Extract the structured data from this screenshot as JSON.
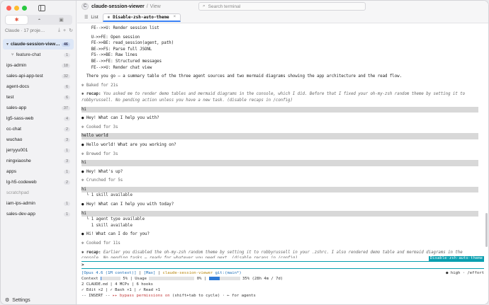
{
  "sidebar": {
    "segments": [
      "✱",
      "◓",
      "▣"
    ],
    "header": "Claude · 17 proje…",
    "projects": [
      {
        "name": "claude-session-view…",
        "count": "46",
        "active": true
      },
      {
        "name": "feature-chat",
        "count": "1",
        "sub": true
      },
      {
        "name": "ips-admin",
        "count": "18"
      },
      {
        "name": "sales-api-app-test",
        "count": "32"
      },
      {
        "name": "agent-docs",
        "count": "6"
      },
      {
        "name": "test",
        "count": "6"
      },
      {
        "name": "sales-app",
        "count": "37"
      },
      {
        "name": "lg5-sass-web",
        "count": "4"
      },
      {
        "name": "cc-chat",
        "count": "2"
      },
      {
        "name": "wuchao",
        "count": "3"
      },
      {
        "name": "jerryyu001",
        "count": "1"
      },
      {
        "name": "ningxiaoshe",
        "count": "3"
      },
      {
        "name": "apps",
        "count": "1"
      },
      {
        "name": "lg-h5-codeweb",
        "count": "2"
      },
      {
        "name": "scratchpad",
        "count": "",
        "muted": true
      },
      {
        "name": "iam-ips-admin",
        "count": "1"
      },
      {
        "name": "sales-dev-app",
        "count": "1"
      }
    ],
    "settings_label": "Settings"
  },
  "topbar": {
    "app_logo": "C",
    "project": "claude-session-viewer",
    "view": "View",
    "search_placeholder": "Search terminal"
  },
  "tabs": [
    {
      "label": "List",
      "active": false
    },
    {
      "label": "Disable-zsh-auto-theme",
      "active": true
    }
  ],
  "terminal": {
    "lines": [
      {
        "k": "t",
        "text": "    FE-->>U: Render session list"
      },
      {
        "k": "g"
      },
      {
        "k": "t",
        "text": "    U->>FE: Open session"
      },
      {
        "k": "t",
        "text": "    FE->>BE: read_session(agent, path)"
      },
      {
        "k": "t",
        "text": "    BE->>FS: Parse full JSONL"
      },
      {
        "k": "t",
        "text": "    FS-->>BE: Raw lines"
      },
      {
        "k": "t",
        "text": "    BE-->>FE: Structured messages"
      },
      {
        "k": "t",
        "text": "    FE-->>U: Render chat view"
      },
      {
        "k": "g"
      },
      {
        "k": "t",
        "text": "  There you go — a summary table of the three agent sources and two mermaid diagrams showing the app architecture and the read flow."
      },
      {
        "k": "g"
      },
      {
        "k": "d",
        "text": "✻ Baked for 21s"
      },
      {
        "k": "g"
      },
      {
        "k": "r",
        "label": "recap:",
        "text": "You asked me to render demo tables and mermaid diagrams in the console, which I did. Before that I fixed your oh-my-zsh random theme by setting it to robbyrussell. No pending action unless you have a new task. (disable recaps in /config)"
      },
      {
        "k": "g"
      },
      {
        "k": "u",
        "text": "hi"
      },
      {
        "k": "g"
      },
      {
        "k": "b",
        "text": "Hey! What can I help you with?"
      },
      {
        "k": "g"
      },
      {
        "k": "d",
        "text": "✻ Cooked for 3s"
      },
      {
        "k": "g"
      },
      {
        "k": "u",
        "text": "hello world"
      },
      {
        "k": "g"
      },
      {
        "k": "b",
        "text": "Hello world! What are you working on?"
      },
      {
        "k": "g"
      },
      {
        "k": "d",
        "text": "✻ Brewed for 3s"
      },
      {
        "k": "g"
      },
      {
        "k": "u",
        "text": "hi"
      },
      {
        "k": "g"
      },
      {
        "k": "b",
        "text": "Hey! What's up?"
      },
      {
        "k": "g"
      },
      {
        "k": "d",
        "text": "✻ Crunched for 5s"
      },
      {
        "k": "g"
      },
      {
        "k": "u",
        "text": "hi"
      },
      {
        "k": "tr",
        "text": "  └ 1 skill available"
      },
      {
        "k": "g"
      },
      {
        "k": "b",
        "text": "Hey! What can I help you with today?"
      },
      {
        "k": "g"
      },
      {
        "k": "u",
        "text": "hi"
      },
      {
        "k": "tr",
        "text": "  └ 1 agent type available"
      },
      {
        "k": "tr",
        "text": "    1 skill available"
      },
      {
        "k": "g"
      },
      {
        "k": "b",
        "text": "Hi! What can I do for you?"
      },
      {
        "k": "g"
      },
      {
        "k": "d",
        "text": "✻ Cooked for 11s"
      },
      {
        "k": "g"
      },
      {
        "k": "r",
        "label": "recap:",
        "text": "Earlier you disabled the oh-my-zsh random theme by setting it to robbyrussell in your .zshrc. I also rendered demo table and mermaid diagrams in the console. No pending tasks — ready for whatever you need next. (disable recaps in /config)"
      }
    ],
    "session_tag": "Disable-zsh-auto-theme",
    "prompt": ">",
    "status": {
      "model": "[Opus 4.6 (1M context)]",
      "plan": "[Max]",
      "dir": "claude-session-viewer",
      "git": "git:(main*)",
      "effort": "● high · /effort",
      "context_label": "Context",
      "context_pct": "5%",
      "context_fill": 0.05,
      "usage_label": "Usage",
      "usage_pct": "0%",
      "week_pct": "35% (28h 4m / 7d)",
      "week_fill": 0.35,
      "config": "2 CLAUDE.md | 4 MCPs | 6 hooks",
      "tools": "✓ Edit ×2 | ✓ Bash ×1 | ✓ Read ×1",
      "mode_prefix": "-- INSERT -- ",
      "mode_bypass": "▸▸ bypass permissions on",
      "mode_suffix": " (shift+tab to cycle) · ← for agents"
    }
  }
}
